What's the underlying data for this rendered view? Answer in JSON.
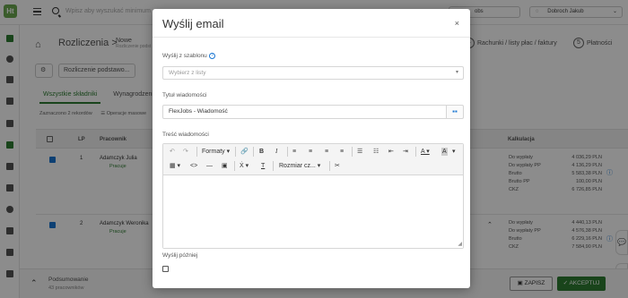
{
  "app": {
    "logo_text": "Ht",
    "search_placeholder": "Wpisz aby wyszukać minimum",
    "company_pill": "obs",
    "user_name": "Dobroch Jakub"
  },
  "page": {
    "breadcrumb_root": "Rozliczenia",
    "breadcrumb_separator": ">",
    "breadcrumb_current": "Nowe",
    "breadcrumb_sub": "Rozliczenie podst",
    "steps": [
      {
        "num": "4",
        "label": "Rachunki / listy płac / faktury"
      },
      {
        "num": "5",
        "label": "Płatności"
      }
    ],
    "toolbar_button": "Rozliczenie podstawo...",
    "tabs": [
      "Wszystkie składniki",
      "Wynagrodzenie"
    ],
    "selection_info": "Zaznaczono 2 rekordów",
    "mass_ops": "Operacje masowe",
    "table_headers": {
      "lp": "LP",
      "employee": "Pracownik",
      "calc": "Kalkulacja"
    },
    "rows": [
      {
        "lp": "1",
        "name": "Adamczyk Julia",
        "status": "Pracuje",
        "calc": [
          {
            "k": "Do wypłaty",
            "v": "4 036,29 PLN"
          },
          {
            "k": "Do wypłaty PP",
            "v": "4 136,29 PLN"
          },
          {
            "k": "Brutto",
            "v": "5 583,38 PLN"
          },
          {
            "k": "Brutto PP",
            "v": "100,00 PLN"
          },
          {
            "k": "CKZ",
            "v": "6 726,85 PLN"
          }
        ]
      },
      {
        "lp": "2",
        "name": "Adamczyk Weronika",
        "status": "Pracuje",
        "calc": [
          {
            "k": "Do wypłaty",
            "v": "4 440,13 PLN"
          },
          {
            "k": "Do wypłaty PP",
            "v": "4 576,38 PLN"
          },
          {
            "k": "Brutto",
            "v": "6 229,16 PLN"
          },
          {
            "k": "CKZ",
            "v": "7 584,90 PLN"
          }
        ]
      }
    ],
    "summary_title": "Podsumowanie",
    "summary_count": "43 pracowników",
    "save_button": "ZAPISZ",
    "accept_button": "AKCEPTUJ"
  },
  "modal": {
    "title": "Wyślij email",
    "close_glyph": "×",
    "template_label": "Wyślij z szablonu",
    "template_placeholder": "Wybierz z listy",
    "subject_label": "Tytuł wiadomości",
    "subject_value": "FlexJobs - Wiadomość",
    "content_label": "Treść wiadomości",
    "formats_label": "Formaty",
    "font_size_label": "Rozmiar cz...",
    "send_later_label": "Wyślij później"
  }
}
